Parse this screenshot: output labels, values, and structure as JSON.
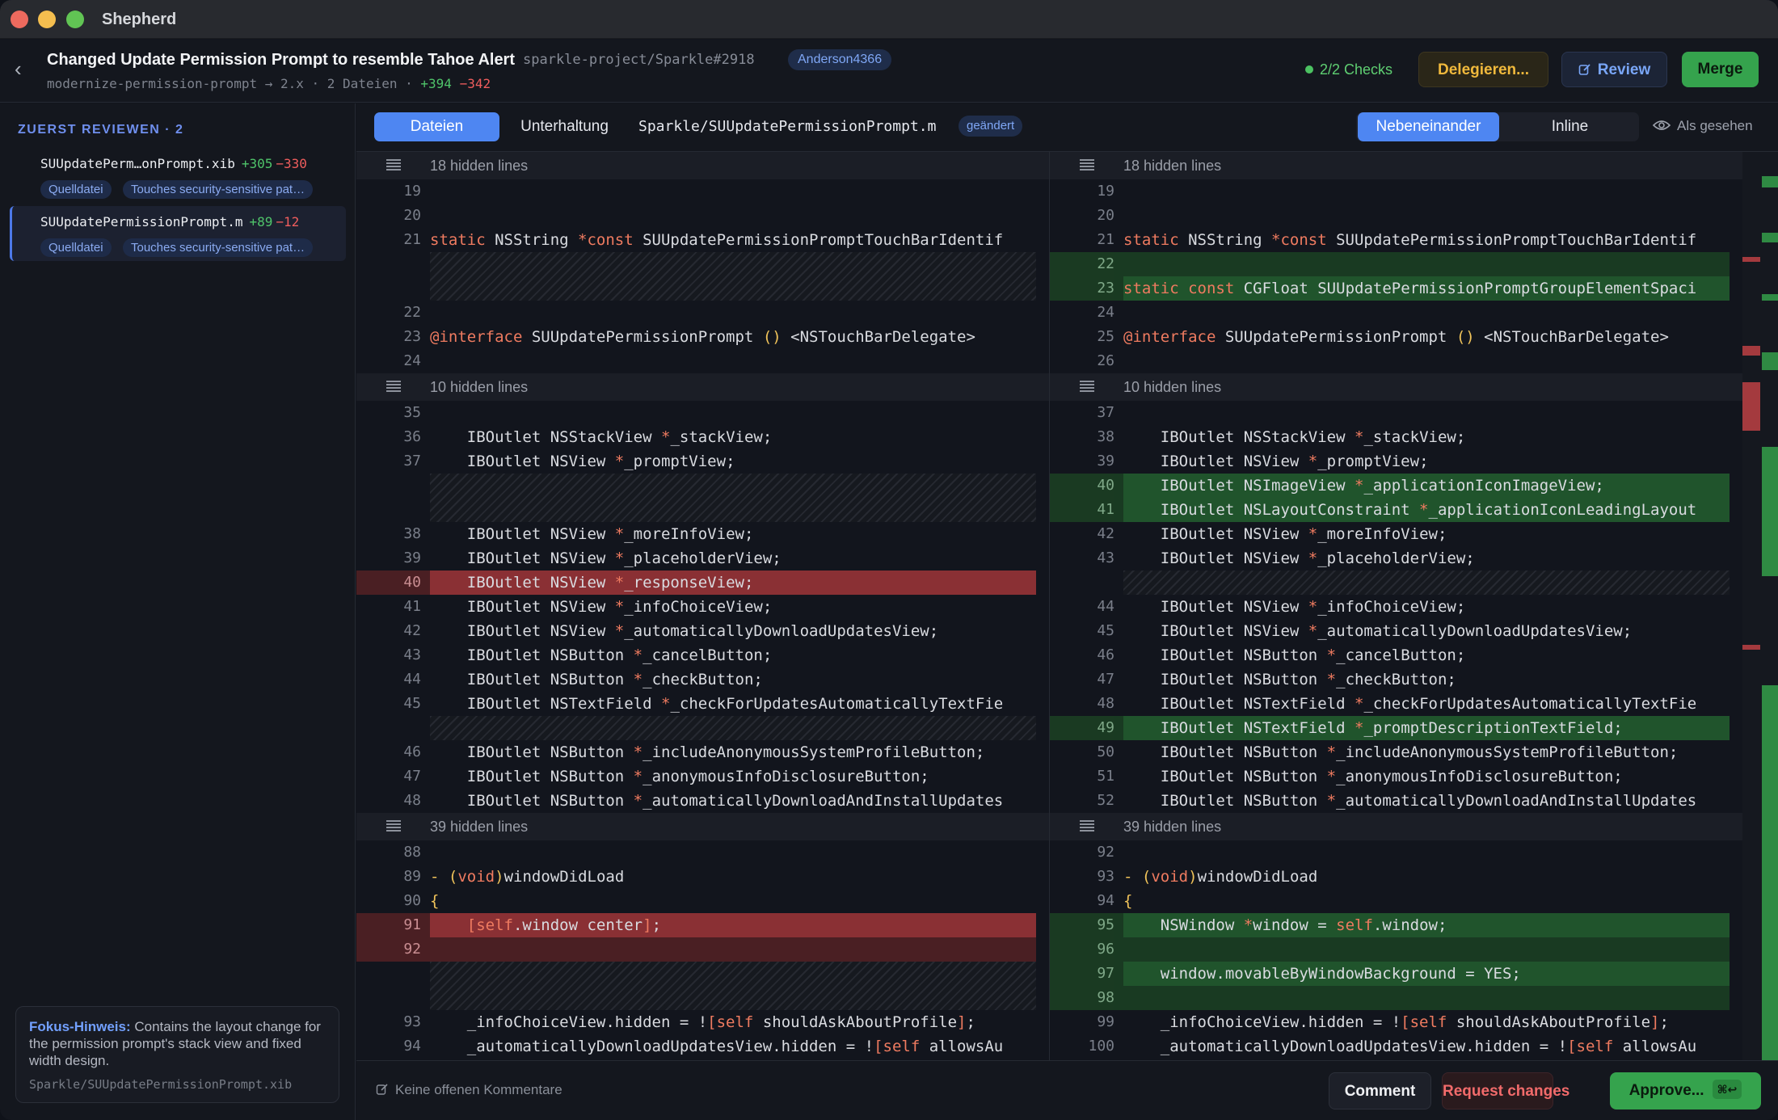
{
  "window": {
    "title": "Shepherd"
  },
  "pr": {
    "title": "Changed Update Permission Prompt to resemble Tahoe Alert",
    "repo_ref": "sparkle-project/Sparkle#2918",
    "author": "Anderson4366",
    "branch_info": "modernize-permission-prompt → 2.x · 2 Dateien ·",
    "additions": "+394",
    "deletions": "−342"
  },
  "header": {
    "checks": "2/2  Checks",
    "delegate_label": "Delegieren...",
    "review_label": "Review",
    "merge_label": "Merge"
  },
  "sidebar": {
    "heading": "ZUERST REVIEWEN · 2",
    "files": [
      {
        "name": "SUUpdatePerm…onPrompt.xib",
        "additions": "+305",
        "deletions": "−330",
        "tag1": "Quelldatei",
        "tag2": "Touches security-sensitive pat…"
      },
      {
        "name": "SUUpdatePermissionPrompt.m",
        "additions": "+89",
        "deletions": "−12",
        "tag1": "Quelldatei",
        "tag2": "Touches security-sensitive pat…"
      }
    ],
    "hint_title": "Fokus-Hinweis:",
    "hint_text": "Contains the layout change for the permission prompt's stack view and fixed width design.",
    "hint_file": "Sparkle/SUUpdatePermissionPrompt.xib"
  },
  "toolbar": {
    "tab_files": "Dateien",
    "tab_conversation": "Unterhaltung",
    "file_path": "Sparkle/SUUpdatePermissionPrompt.m",
    "changed_badge": "geändert",
    "view_side": "Nebeneinander",
    "view_inline": "Inline",
    "seen_label": "Als gesehen"
  },
  "diff": {
    "left": [
      {
        "t": "hidden",
        "text": "18 hidden lines"
      },
      {
        "t": "ctx",
        "n": "19",
        "h": ""
      },
      {
        "t": "ctx",
        "n": "20",
        "h": ""
      },
      {
        "t": "ctx",
        "n": "21",
        "h": "<span class='kw'>static</span> NSString <span class='kw'>*const</span> SUUpdatePermissionPromptTouchBarIdentif"
      },
      {
        "t": "fill",
        "rows": 2
      },
      {
        "t": "ctx",
        "n": "22",
        "h": ""
      },
      {
        "t": "ctx",
        "n": "23",
        "h": "<span class='at'>@interface</span> SUUpdatePermissionPrompt <span class='pu'>()</span> &lt;NSTouchBarDelegate&gt;"
      },
      {
        "t": "ctx",
        "n": "24",
        "h": ""
      },
      {
        "t": "hidden",
        "text": "10 hidden lines"
      },
      {
        "t": "ctx",
        "n": "35",
        "h": ""
      },
      {
        "t": "ctx",
        "n": "36",
        "h": "    IBOutlet NSStackView <span class='kw'>*</span>_stackView;"
      },
      {
        "t": "ctx",
        "n": "37",
        "h": "    IBOutlet NSView <span class='kw'>*</span>_promptView;"
      },
      {
        "t": "fill",
        "rows": 2
      },
      {
        "t": "ctx",
        "n": "38",
        "h": "    IBOutlet NSView <span class='kw'>*</span>_moreInfoView;"
      },
      {
        "t": "ctx",
        "n": "39",
        "h": "    IBOutlet NSView <span class='kw'>*</span>_placeholderView;"
      },
      {
        "t": "del",
        "n": "40",
        "h": "    IBOutlet NSView <span class='kw'>*</span>_responseView;"
      },
      {
        "t": "ctx",
        "n": "41",
        "h": "    IBOutlet NSView <span class='kw'>*</span>_infoChoiceView;"
      },
      {
        "t": "ctx",
        "n": "42",
        "h": "    IBOutlet NSView <span class='kw'>*</span>_automaticallyDownloadUpdatesView;"
      },
      {
        "t": "ctx",
        "n": "43",
        "h": "    IBOutlet NSButton <span class='kw'>*</span>_cancelButton;"
      },
      {
        "t": "ctx",
        "n": "44",
        "h": "    IBOutlet NSButton <span class='kw'>*</span>_checkButton;"
      },
      {
        "t": "ctx",
        "n": "45",
        "h": "    IBOutlet NSTextField <span class='kw'>*</span>_checkForUpdatesAutomaticallyTextFie"
      },
      {
        "t": "fill",
        "rows": 1
      },
      {
        "t": "ctx",
        "n": "46",
        "h": "    IBOutlet NSButton <span class='kw'>*</span>_includeAnonymousSystemProfileButton;"
      },
      {
        "t": "ctx",
        "n": "47",
        "h": "    IBOutlet NSButton <span class='kw'>*</span>_anonymousInfoDisclosureButton;"
      },
      {
        "t": "ctx",
        "n": "48",
        "h": "    IBOutlet NSButton <span class='kw'>*</span>_automaticallyDownloadAndInstallUpdates"
      },
      {
        "t": "hidden",
        "text": "39 hidden lines"
      },
      {
        "t": "ctx",
        "n": "88",
        "h": ""
      },
      {
        "t": "ctx",
        "n": "89",
        "h": "<span class='pu'>-</span> <span class='pu'>(</span><span class='kw'>void</span><span class='pu'>)</span>windowDidLoad"
      },
      {
        "t": "ctx",
        "n": "90",
        "h": "<span class='pu'>{</span>"
      },
      {
        "t": "del",
        "n": "91",
        "h": "    <span class='kw'>[self</span>.window center<span class='kw'>]</span>;"
      },
      {
        "t": "del",
        "n": "92",
        "h": ""
      },
      {
        "t": "fill",
        "rows": 2
      },
      {
        "t": "ctx",
        "n": "93",
        "h": "    _infoChoiceView.hidden = !<span class='kw'>[self</span> shouldAskAboutProfile<span class='kw'>]</span>;"
      },
      {
        "t": "ctx",
        "n": "94",
        "h": "    _automaticallyDownloadUpdatesView.hidden = !<span class='kw'>[self</span> allowsAu"
      }
    ],
    "right": [
      {
        "t": "hidden",
        "text": "18 hidden lines"
      },
      {
        "t": "ctx",
        "n": "19",
        "h": ""
      },
      {
        "t": "ctx",
        "n": "20",
        "h": ""
      },
      {
        "t": "ctx",
        "n": "21",
        "h": "<span class='kw'>static</span> NSString <span class='kw'>*const</span> SUUpdatePermissionPromptTouchBarIdentif"
      },
      {
        "t": "add",
        "n": "22",
        "h": ""
      },
      {
        "t": "add",
        "n": "23",
        "h": "<span class='kw'>static</span> <span class='kw'>const</span> CGFloat SUUpdatePermissionPromptGroupElementSpaci"
      },
      {
        "t": "ctx",
        "n": "24",
        "h": ""
      },
      {
        "t": "ctx",
        "n": "25",
        "h": "<span class='at'>@interface</span> SUUpdatePermissionPrompt <span class='pu'>()</span> &lt;NSTouchBarDelegate&gt;"
      },
      {
        "t": "ctx",
        "n": "26",
        "h": ""
      },
      {
        "t": "hidden",
        "text": "10 hidden lines"
      },
      {
        "t": "ctx",
        "n": "37",
        "h": ""
      },
      {
        "t": "ctx",
        "n": "38",
        "h": "    IBOutlet NSStackView <span class='kw'>*</span>_stackView;"
      },
      {
        "t": "ctx",
        "n": "39",
        "h": "    IBOutlet NSView <span class='kw'>*</span>_promptView;"
      },
      {
        "t": "add",
        "n": "40",
        "h": "    IBOutlet NSImageView <span class='kw'>*</span>_applicationIconImageView;"
      },
      {
        "t": "add",
        "n": "41",
        "h": "    IBOutlet NSLayoutConstraint <span class='kw'>*</span>_applicationIconLeadingLayout"
      },
      {
        "t": "ctx",
        "n": "42",
        "h": "    IBOutlet NSView <span class='kw'>*</span>_moreInfoView;"
      },
      {
        "t": "ctx",
        "n": "43",
        "h": "    IBOutlet NSView <span class='kw'>*</span>_placeholderView;"
      },
      {
        "t": "fill",
        "rows": 1
      },
      {
        "t": "ctx",
        "n": "44",
        "h": "    IBOutlet NSView <span class='kw'>*</span>_infoChoiceView;"
      },
      {
        "t": "ctx",
        "n": "45",
        "h": "    IBOutlet NSView <span class='kw'>*</span>_automaticallyDownloadUpdatesView;"
      },
      {
        "t": "ctx",
        "n": "46",
        "h": "    IBOutlet NSButton <span class='kw'>*</span>_cancelButton;"
      },
      {
        "t": "ctx",
        "n": "47",
        "h": "    IBOutlet NSButton <span class='kw'>*</span>_checkButton;"
      },
      {
        "t": "ctx",
        "n": "48",
        "h": "    IBOutlet NSTextField <span class='kw'>*</span>_checkForUpdatesAutomaticallyTextFie"
      },
      {
        "t": "add",
        "n": "49",
        "h": "    IBOutlet NSTextField <span class='kw'>*</span>_promptDescriptionTextField;"
      },
      {
        "t": "ctx",
        "n": "50",
        "h": "    IBOutlet NSButton <span class='kw'>*</span>_includeAnonymousSystemProfileButton;"
      },
      {
        "t": "ctx",
        "n": "51",
        "h": "    IBOutlet NSButton <span class='kw'>*</span>_anonymousInfoDisclosureButton;"
      },
      {
        "t": "ctx",
        "n": "52",
        "h": "    IBOutlet NSButton <span class='kw'>*</span>_automaticallyDownloadAndInstallUpdates"
      },
      {
        "t": "hidden",
        "text": "39 hidden lines"
      },
      {
        "t": "ctx",
        "n": "92",
        "h": ""
      },
      {
        "t": "ctx",
        "n": "93",
        "h": "<span class='pu'>-</span> <span class='pu'>(</span><span class='kw'>void</span><span class='pu'>)</span>windowDidLoad"
      },
      {
        "t": "ctx",
        "n": "94",
        "h": "<span class='pu'>{</span>"
      },
      {
        "t": "add",
        "n": "95",
        "h": "    NSWindow <span class='kw'>*</span>window = <span class='kw'>self</span>.window;"
      },
      {
        "t": "add",
        "n": "96",
        "h": ""
      },
      {
        "t": "add",
        "n": "97",
        "h": "    window.movableByWindowBackground = YES;"
      },
      {
        "t": "add",
        "n": "98",
        "h": ""
      },
      {
        "t": "ctx",
        "n": "99",
        "h": "    _infoChoiceView.hidden = !<span class='kw'>[self</span> shouldAskAboutProfile<span class='kw'>]</span>;"
      },
      {
        "t": "ctx",
        "n": "100",
        "h": "    _automaticallyDownloadUpdatesView.hidden = !<span class='kw'>[self</span> allowsAu"
      }
    ]
  },
  "footer": {
    "note": "Keine offenen Kommentare",
    "comment_label": "Comment",
    "request_label": "Request changes",
    "approve_label": "Approve...",
    "approve_shortcut": "⌘↩"
  },
  "colors": {
    "accent": "#4e86f2",
    "added": "#20542c",
    "removed": "#8a3034",
    "merge": "#35a34d"
  }
}
